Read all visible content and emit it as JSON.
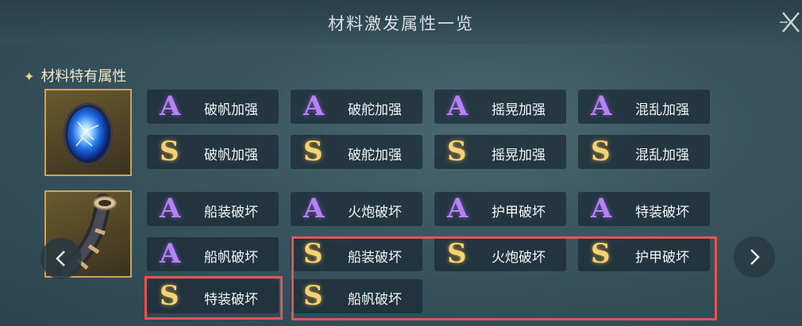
{
  "header": {
    "title": "材料激发属性一览"
  },
  "section": {
    "star": "✦",
    "title": "材料特有属性"
  },
  "colors": {
    "grade_a": "#b583f2",
    "grade_s": "#f6d274",
    "highlight": "#e25555",
    "section_title": "#f1e7c3"
  },
  "materials": [
    {
      "icon": "blue-orb-icon",
      "attributes": [
        {
          "grade": "A",
          "label": "破帆加强"
        },
        {
          "grade": "A",
          "label": "破舵加强"
        },
        {
          "grade": "A",
          "label": "摇晃加强"
        },
        {
          "grade": "A",
          "label": "混乱加强"
        },
        {
          "grade": "S",
          "label": "破帆加强"
        },
        {
          "grade": "S",
          "label": "破舵加强"
        },
        {
          "grade": "S",
          "label": "摇晃加强"
        },
        {
          "grade": "S",
          "label": "混乱加强"
        }
      ]
    },
    {
      "icon": "horn-icon",
      "attributes": [
        {
          "grade": "A",
          "label": "船装破坏"
        },
        {
          "grade": "A",
          "label": "火炮破坏"
        },
        {
          "grade": "A",
          "label": "护甲破坏"
        },
        {
          "grade": "A",
          "label": "特装破坏"
        },
        {
          "grade": "A",
          "label": "船帆破坏"
        },
        {
          "grade": "S",
          "label": "船装破坏"
        },
        {
          "grade": "S",
          "label": "火炮破坏"
        },
        {
          "grade": "S",
          "label": "护甲破坏"
        },
        {
          "grade": "S",
          "label": "特装破坏"
        },
        {
          "grade": "S",
          "label": "船帆破坏"
        }
      ]
    }
  ]
}
